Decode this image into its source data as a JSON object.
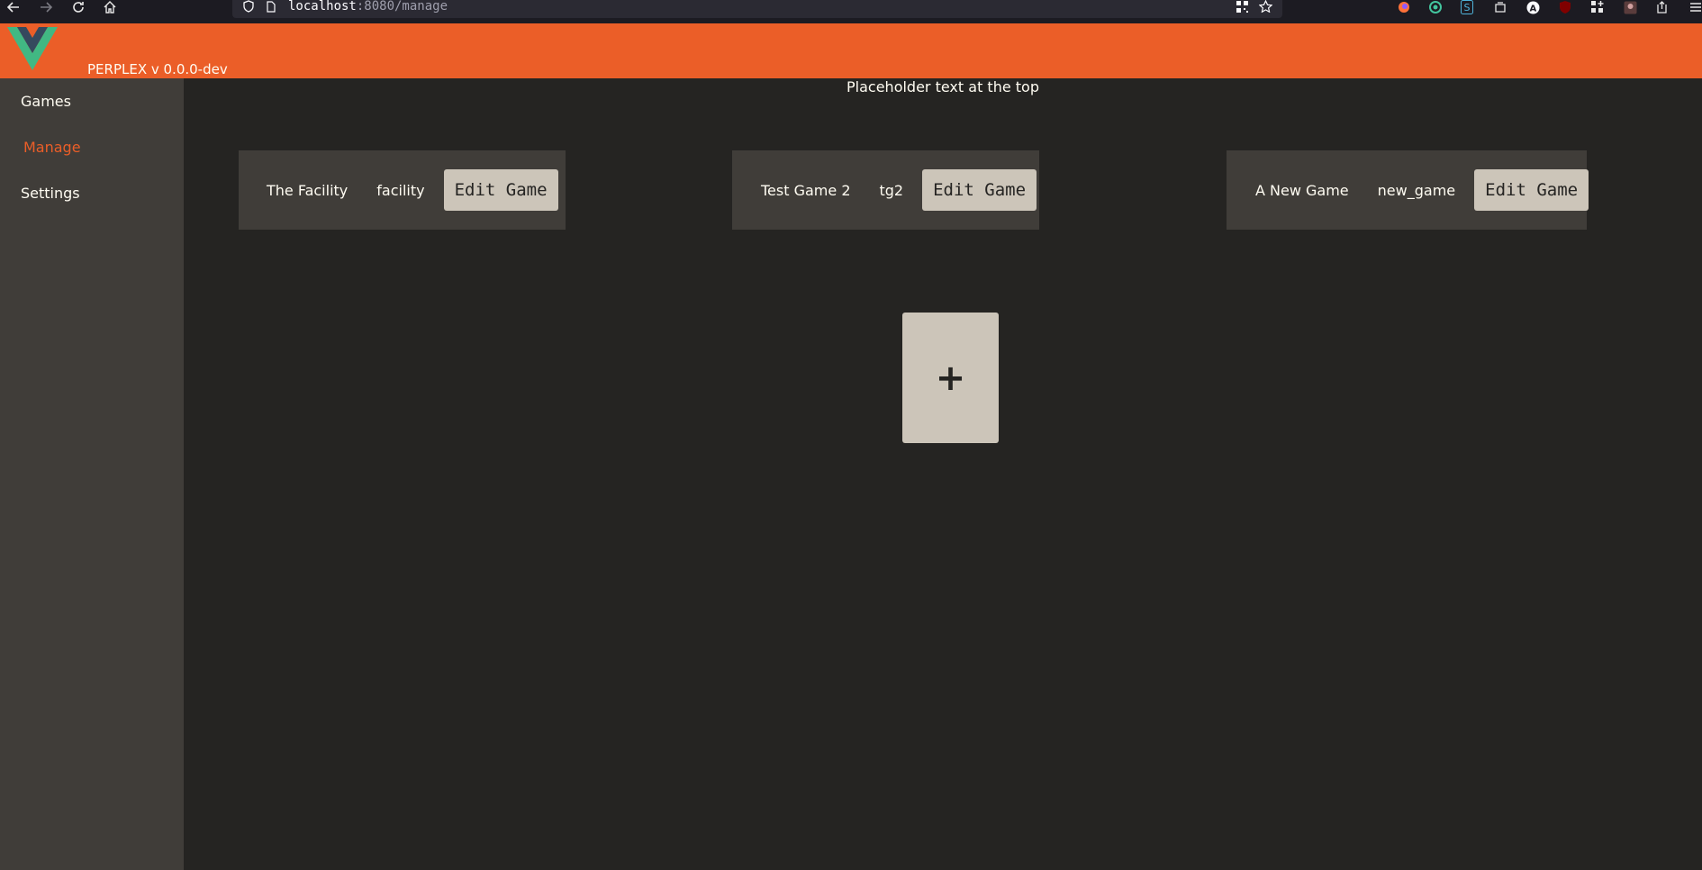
{
  "browser": {
    "url_host": "localhost",
    "url_path": ":8080/manage"
  },
  "app": {
    "version_label": "PERPLEX v 0.0.0-dev"
  },
  "sidebar": {
    "items": [
      {
        "label": "Games",
        "active": false
      },
      {
        "label": "Manage",
        "active": true
      },
      {
        "label": "Settings",
        "active": false
      }
    ]
  },
  "main": {
    "placeholder_text": "Placeholder text at the top",
    "games": [
      {
        "name": "The Facility",
        "slug": "facility",
        "edit_label": "Edit Game"
      },
      {
        "name": "Test Game 2",
        "slug": "tg2",
        "edit_label": "Edit Game"
      },
      {
        "name": "A New Game",
        "slug": "new_game",
        "edit_label": "Edit Game"
      }
    ],
    "add_label": "+"
  },
  "colors": {
    "accent": "#eb5e28",
    "background": "#252422",
    "panel": "#403d39",
    "button": "#ccc5b9",
    "text": "#fffcf2"
  }
}
